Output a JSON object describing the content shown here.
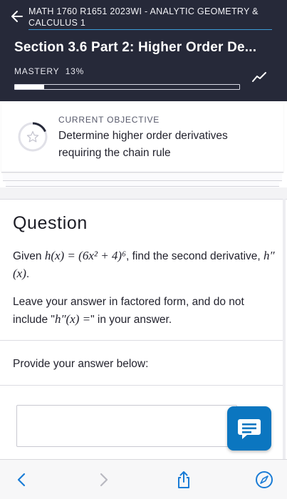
{
  "header": {
    "course_title": "MATH 1760 R1651 2023WI - ANALYTIC GEOMETRY & CALCULUS 1",
    "section_title": "Section 3.6 Part 2: Higher Order De...",
    "mastery_label": "MASTERY",
    "mastery_percent_text": "13%",
    "mastery_fraction": 0.13
  },
  "objective": {
    "label": "CURRENT OBJECTIVE",
    "text": "Determine higher order derivatives requiring the chain rule"
  },
  "question": {
    "heading": "Question",
    "given_prefix": "Given ",
    "given_function": "h(x) = (6x² + 4)⁶",
    "given_mid": ", find the second derivative, ",
    "given_derivative": "h″(x)",
    "given_end": ".",
    "instr_prefix": "Leave your answer in factored form, and do not include \"",
    "instr_math": "h″(x) =",
    "instr_suffix": "\" in your answer.",
    "provide_label": "Provide your answer below:",
    "answer_value": ""
  },
  "colors": {
    "header_bg": "#262939",
    "accent": "#3d9bd6",
    "chat_button": "#0b76c0",
    "browser_icon": "#1a7cd6",
    "browser_icon_disabled": "#b8b8c0"
  },
  "icons": {
    "back": "arrow-left-icon",
    "trend": "trend-line-icon",
    "objective": "star-ring-icon",
    "chat": "chat-bubble-icon",
    "browser_back": "chevron-left-icon",
    "browser_forward": "chevron-right-icon",
    "share": "share-icon",
    "compass": "compass-icon"
  }
}
